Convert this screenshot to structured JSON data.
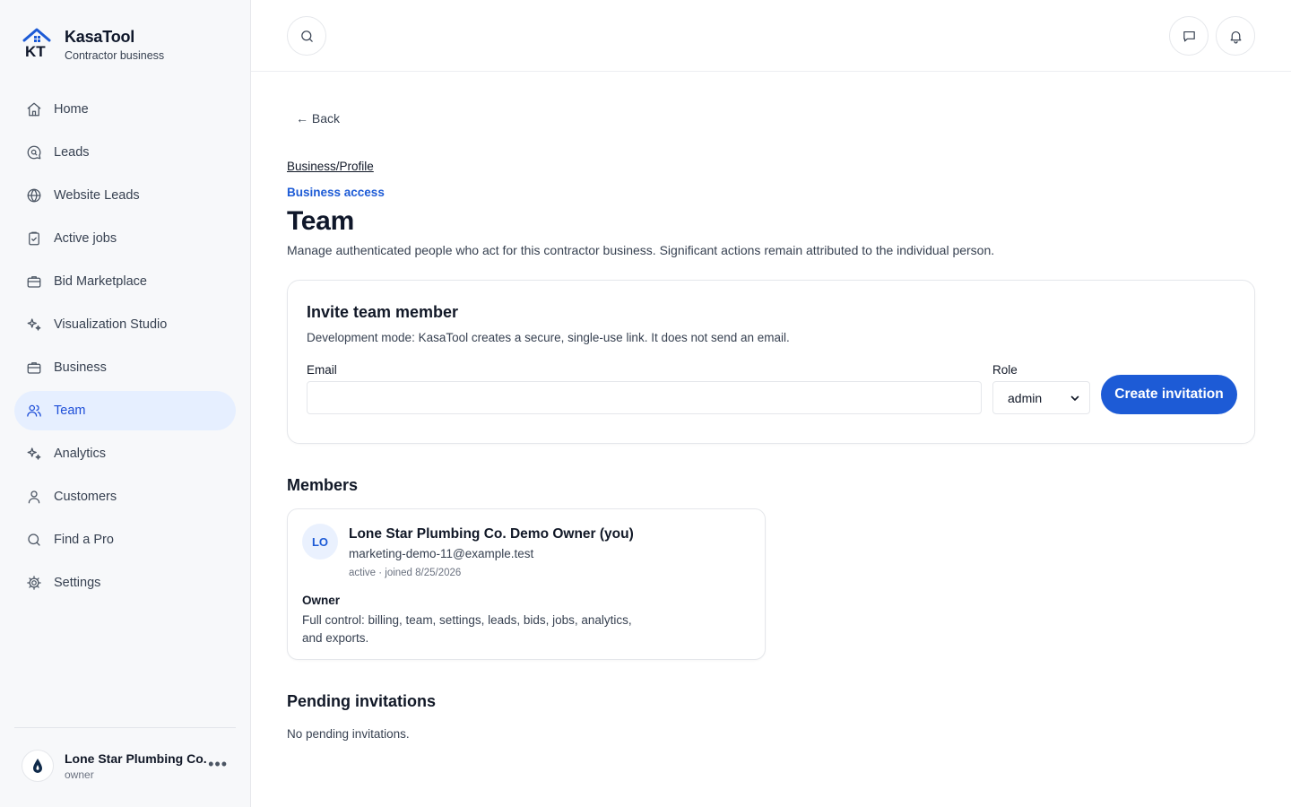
{
  "brand": {
    "name": "KasaTool",
    "subtitle": "Contractor business",
    "logo_text": "KT"
  },
  "nav": {
    "items": [
      {
        "label": "Home",
        "icon": "home-icon",
        "active": false
      },
      {
        "label": "Leads",
        "icon": "chat-search-icon",
        "active": false
      },
      {
        "label": "Website Leads",
        "icon": "globe-icon",
        "active": false
      },
      {
        "label": "Active jobs",
        "icon": "clipboard-check-icon",
        "active": false
      },
      {
        "label": "Bid Marketplace",
        "icon": "briefcase-icon",
        "active": false
      },
      {
        "label": "Visualization Studio",
        "icon": "sparkles-icon",
        "active": false
      },
      {
        "label": "Business",
        "icon": "briefcase-icon",
        "active": false
      },
      {
        "label": "Team",
        "icon": "users-icon",
        "active": true
      },
      {
        "label": "Analytics",
        "icon": "sparkles-icon",
        "active": false
      },
      {
        "label": "Customers",
        "icon": "user-icon",
        "active": false
      },
      {
        "label": "Find a Pro",
        "icon": "search-icon",
        "active": false
      },
      {
        "label": "Settings",
        "icon": "gear-icon",
        "active": false
      }
    ]
  },
  "account": {
    "name": "Lone Star Plumbing Co.",
    "role": "owner",
    "more": "•••"
  },
  "page": {
    "back_label": "←  Back",
    "breadcrumb": "Business/Profile",
    "eyebrow": "Business access",
    "title": "Team",
    "description": "Manage authenticated people who act for this contractor business. Significant actions remain attributed to the individual person."
  },
  "invite": {
    "title": "Invite team member",
    "description": "Development mode: KasaTool creates a secure, single-use link. It does not send an email.",
    "email_label": "Email",
    "email_value": "",
    "role_label": "Role",
    "role_value": "admin",
    "submit_label": "Create invitation"
  },
  "members": {
    "heading": "Members",
    "list": [
      {
        "initials": "LO",
        "name": "Lone Star Plumbing Co. Demo Owner (you)",
        "email": "marketing-demo-11@example.test",
        "meta": "active · joined 8/25/2026",
        "role": "Owner",
        "role_description": "Full control: billing, team, settings, leads, bids, jobs, analytics, and exports."
      }
    ]
  },
  "pending": {
    "heading": "Pending invitations",
    "empty_text": "No pending invitations."
  },
  "colors": {
    "accent": "#1d5bd6",
    "active_nav_bg": "#e6efff",
    "sidebar_bg": "#f7f8fa"
  }
}
